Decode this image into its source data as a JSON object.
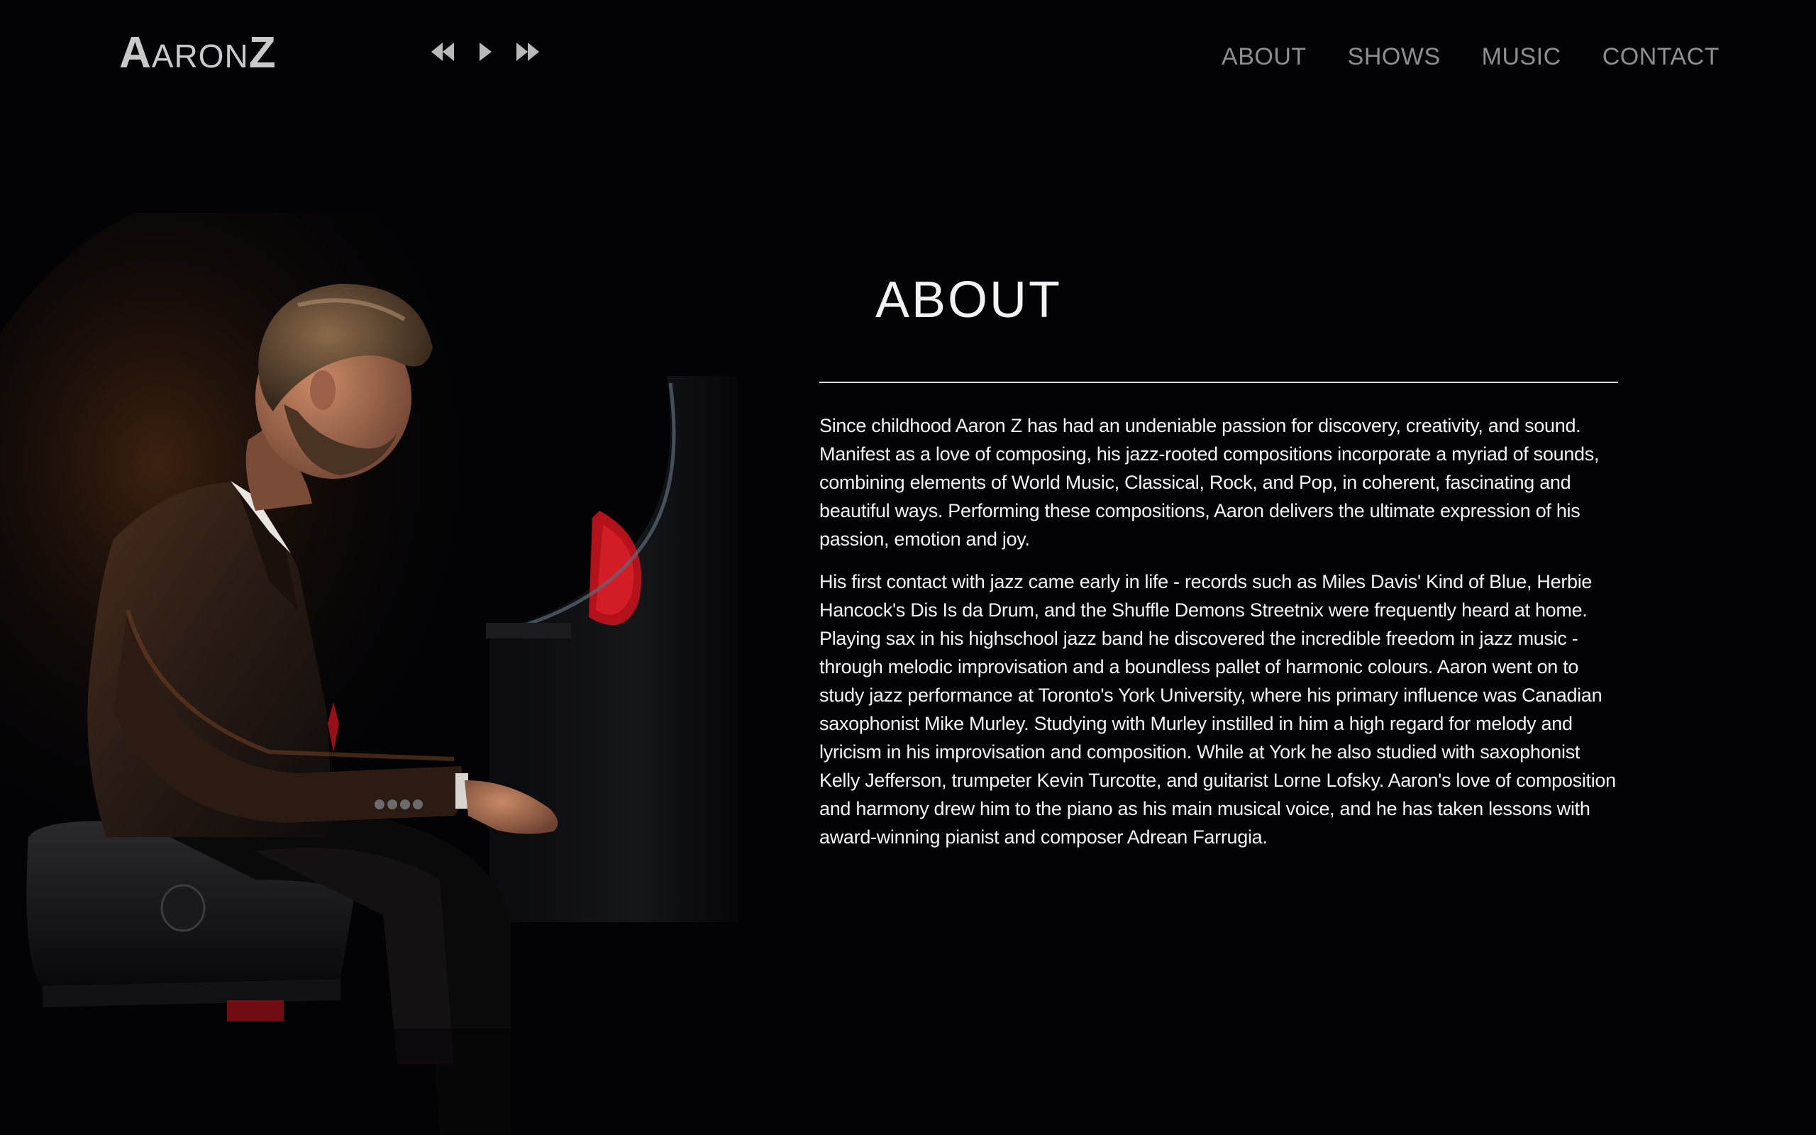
{
  "logo": {
    "first_initial": "A",
    "first_rest": "ARON",
    "last_initial": "Z"
  },
  "player": {
    "prev_icon": "rewind-icon",
    "play_icon": "play-icon",
    "next_icon": "fast-forward-icon"
  },
  "nav": {
    "items": [
      {
        "label": "ABOUT"
      },
      {
        "label": "SHOWS"
      },
      {
        "label": "MUSIC"
      },
      {
        "label": "CONTACT"
      }
    ]
  },
  "about": {
    "title": "ABOUT",
    "paragraphs": [
      "Since childhood Aaron Z has had an undeniable passion for discovery, creativity, and sound. Manifest as a love of composing, his jazz-rooted compositions incorporate a myriad of sounds, combining elements of World Music, Classical, Rock, and Pop, in coherent, fascinating and beautiful ways. Performing these compositions, Aaron delivers the ultimate expression of his passion, emotion and joy.",
      "His first contact with jazz came early in life - records such as Miles Davis' Kind of Blue, Herbie Hancock's Dis Is da Drum, and the Shuffle Demons Streetnix were frequently heard at home. Playing sax in his highschool jazz band he discovered the incredible freedom in jazz music - through melodic improvisation and a boundless pallet of harmonic colours. Aaron went on to study jazz performance at Toronto's York University, where his primary influence was Canadian saxophonist Mike Murley. Studying with Murley instilled in him a high regard for melody and lyricism in his improvisation and composition. While at York he also studied with saxophonist Kelly Jefferson, trumpeter Kevin Turcotte, and guitarist Lorne Lofsky. Aaron's love of composition and harmony drew him to the piano as his main musical voice, and he has taken lessons with award-winning pianist and composer Adrean Farrugia."
    ]
  },
  "colors": {
    "background": "#030305",
    "nav_text": "#8e8e8e",
    "logo_text": "#c9c9c9",
    "accent_red": "#b3121b"
  }
}
